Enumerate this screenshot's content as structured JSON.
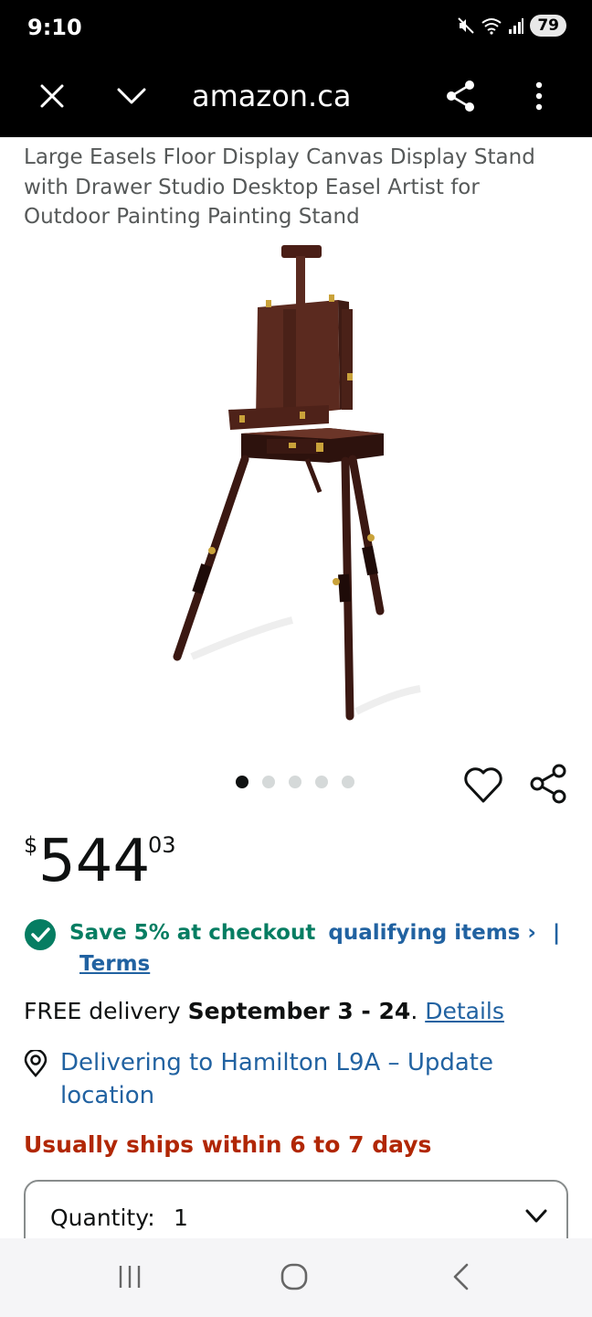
{
  "status_bar": {
    "time": "9:10",
    "battery": "79",
    "icons": [
      "mute-icon",
      "wifi-icon",
      "signal-icon"
    ]
  },
  "browser": {
    "url": "amazon.ca",
    "icons": [
      "close-icon",
      "chevron-down-icon",
      "share-icon",
      "more-icon"
    ]
  },
  "product": {
    "title": "Large Easels Floor Display Canvas Display Stand with Drawer Studio Desktop Easel Artist for Outdoor Painting Painting Stand",
    "image_count": 5,
    "active_image": 1
  },
  "price": {
    "symbol": "$",
    "whole": "544",
    "fraction": "03"
  },
  "coupon": {
    "save_text": "Save 5% at checkout",
    "items_link": "qualifying items ›",
    "separator": "|",
    "terms_link": "Terms"
  },
  "delivery": {
    "prefix": "FREE delivery ",
    "dates": "September 3 - 24",
    "suffix": ". ",
    "details_link": "Details"
  },
  "location": {
    "text": "Delivering to Hamilton L9A – Update location"
  },
  "shipping": {
    "text": "Usually ships within 6 to 7 days"
  },
  "quantity": {
    "label": "Quantity:",
    "value": "1"
  },
  "colors": {
    "link": "#2162a1",
    "success": "#067d62",
    "alert": "#b12704"
  }
}
